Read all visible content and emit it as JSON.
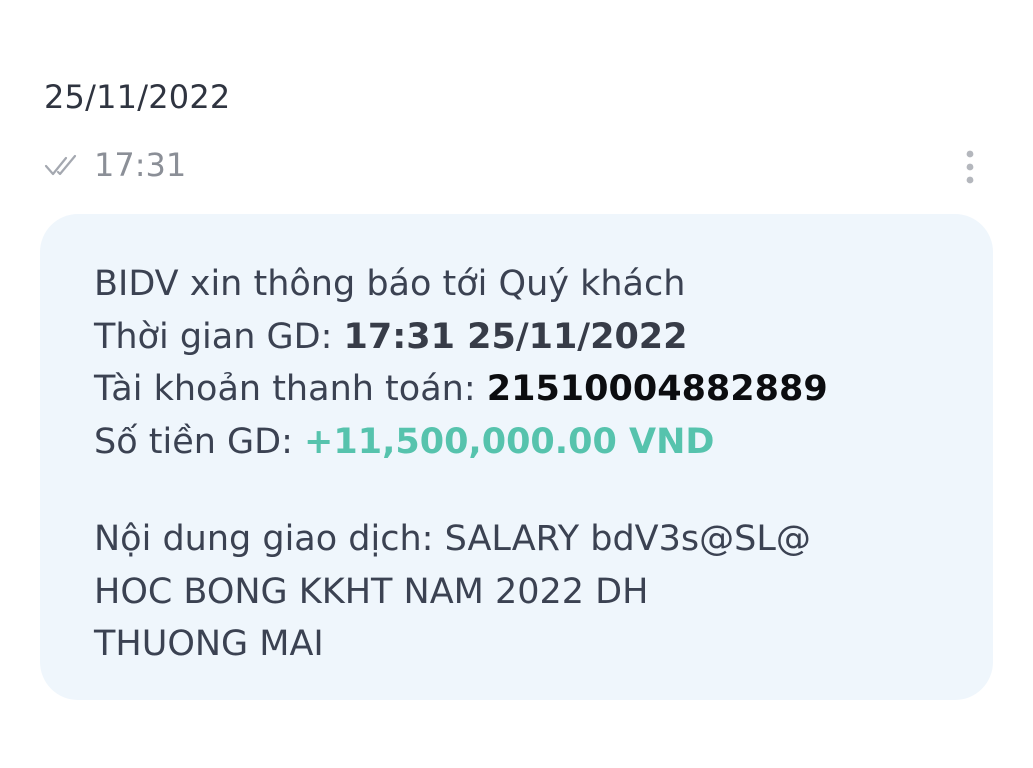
{
  "header": {
    "date": "25/11/2022"
  },
  "meta": {
    "time": "17:31",
    "seen_icon": "double-check-icon",
    "more_icon": "more-vertical-icon"
  },
  "message": {
    "greeting": "BIDV xin thông báo tới Quý khách",
    "txn_time_label": "Thời gian GD: ",
    "txn_time_value": "17:31 25/11/2022",
    "account_label": "Tài khoản thanh toán: ",
    "account_value": "21510004882889",
    "amount_label": "Số tiền GD: ",
    "amount_value": "+11,500,000.00 VND",
    "content_line1": "Nội dung giao dịch: SALARY bdV3s@SL@",
    "content_line2": "HOC BONG KKHT NAM 2022 DH",
    "content_line3": "THUONG MAI"
  },
  "colors": {
    "bubble_bg": "#eff6fc",
    "text": "#3b4252",
    "amount": "#56c3ad",
    "time": "#8b8f97"
  }
}
